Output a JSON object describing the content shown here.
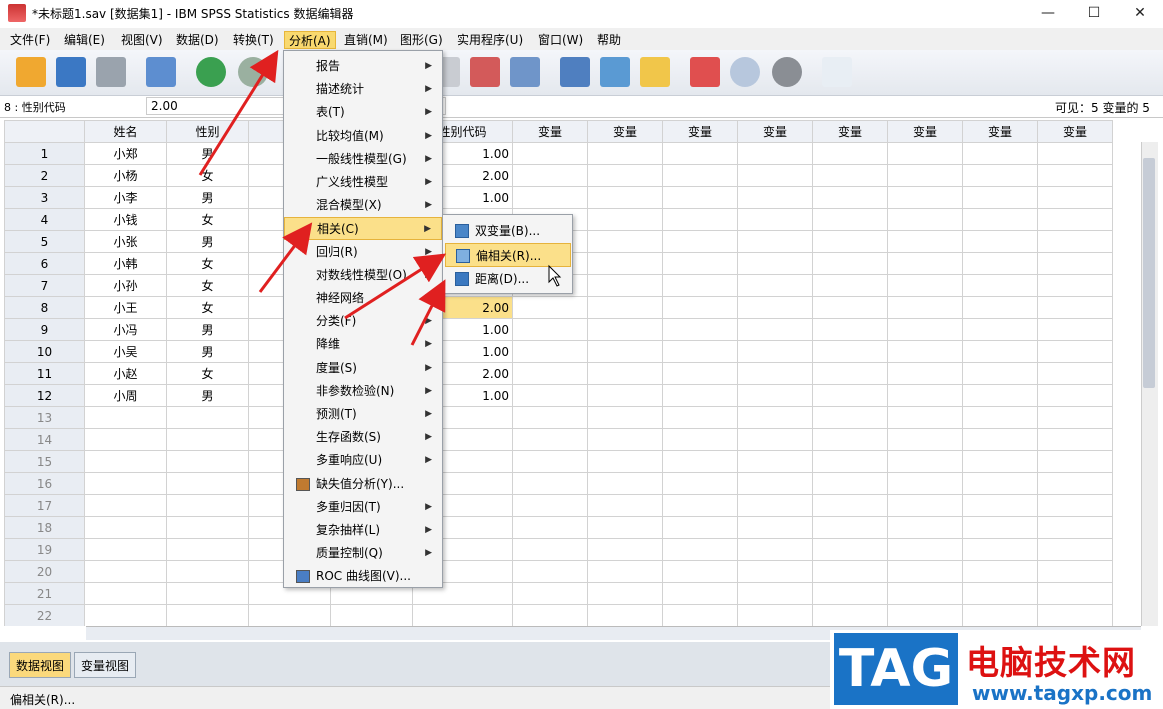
{
  "window": {
    "title": "*未标题1.sav [数据集1] - IBM SPSS Statistics 数据编辑器",
    "min": "—",
    "max": "☐",
    "close": "✕"
  },
  "menubar": [
    "文件(F)",
    "编辑(E)",
    "视图(V)",
    "数据(D)",
    "转换(T)",
    "分析(A)",
    "直销(M)",
    "图形(G)",
    "实用程序(U)",
    "窗口(W)",
    "帮助"
  ],
  "cellbar": {
    "ref": "8 : 性别代码",
    "value": "2.00",
    "visible": "可见：5 变量的 5"
  },
  "columns": [
    "姓名",
    "性别",
    "",
    "",
    "性别代码",
    "变量",
    "变量",
    "变量",
    "变量",
    "变量",
    "变量",
    "变量",
    "变量"
  ],
  "rows": [
    {
      "n": "1",
      "name": "小郑",
      "sex": "男",
      "code": "1.00"
    },
    {
      "n": "2",
      "name": "小杨",
      "sex": "女",
      "code": "2.00"
    },
    {
      "n": "3",
      "name": "小李",
      "sex": "男",
      "code": "1.00"
    },
    {
      "n": "4",
      "name": "小钱",
      "sex": "女",
      "code": ""
    },
    {
      "n": "5",
      "name": "小张",
      "sex": "男",
      "code": ""
    },
    {
      "n": "6",
      "name": "小韩",
      "sex": "女",
      "code": ""
    },
    {
      "n": "7",
      "name": "小孙",
      "sex": "女",
      "code": ""
    },
    {
      "n": "8",
      "name": "小王",
      "sex": "女",
      "code": "2.00"
    },
    {
      "n": "9",
      "name": "小冯",
      "sex": "男",
      "code": "1.00"
    },
    {
      "n": "10",
      "name": "小吴",
      "sex": "男",
      "code": "1.00"
    },
    {
      "n": "11",
      "name": "小赵",
      "sex": "女",
      "code": "2.00"
    },
    {
      "n": "12",
      "name": "小周",
      "sex": "男",
      "code": "1.00"
    }
  ],
  "empty_rows": [
    "13",
    "14",
    "15",
    "16",
    "17",
    "18",
    "19",
    "20",
    "21",
    "22"
  ],
  "analyze_menu": [
    "报告",
    "描述统计",
    "表(T)",
    "比较均值(M)",
    "一般线性模型(G)",
    "广义线性模型",
    "混合模型(X)",
    "相关(C)",
    "回归(R)",
    "对数线性模型(O)",
    "神经网络",
    "分类(F)",
    "降维",
    "度量(S)",
    "非参数检验(N)",
    "预测(T)",
    "生存函数(S)",
    "多重响应(U)",
    "缺失值分析(Y)...",
    "多重归因(T)",
    "复杂抽样(L)",
    "质量控制(Q)",
    "ROC 曲线图(V)..."
  ],
  "correlate_submenu": [
    "双变量(B)...",
    "偏相关(R)...",
    "距离(D)..."
  ],
  "tabs": {
    "data_view": "数据视图",
    "variable_view": "变量视图"
  },
  "status": "偏相关(R)...",
  "watermark": {
    "logo": "TAG",
    "title": "电脑技术网",
    "url": "www.tagxp.com"
  },
  "colors": {
    "highlight": "#fbe08a",
    "arrow": "#e02020"
  }
}
